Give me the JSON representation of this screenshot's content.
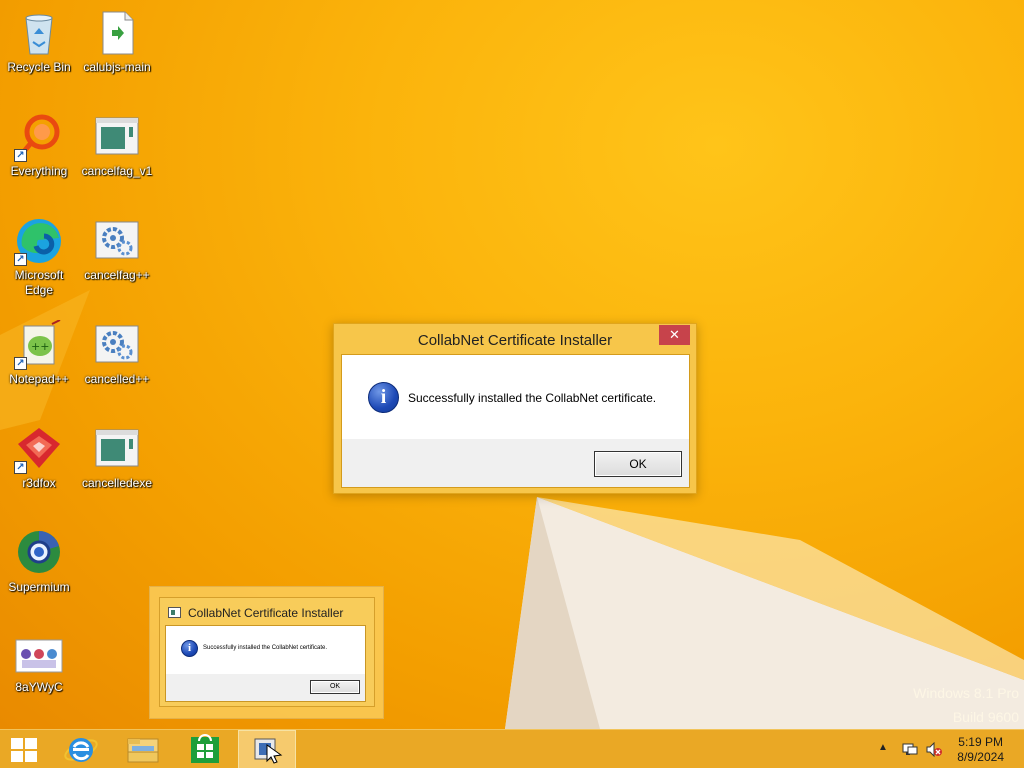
{
  "desktop": {
    "icons": [
      {
        "label": "Recycle Bin",
        "icon": "recycle-bin-icon"
      },
      {
        "label": "calubjs-main",
        "icon": "file-icon"
      },
      {
        "label": "Everything",
        "icon": "everything-search-icon"
      },
      {
        "label": "cancelfag_v1",
        "icon": "app-window-icon"
      },
      {
        "label": "Microsoft Edge",
        "icon": "edge-icon"
      },
      {
        "label": "cancelfag++",
        "icon": "gear-icon"
      },
      {
        "label": "Notepad++",
        "icon": "notepad-plus-plus-icon"
      },
      {
        "label": "cancelled++",
        "icon": "gear-icon"
      },
      {
        "label": "r3dfox",
        "icon": "r3dfox-icon"
      },
      {
        "label": "cancelledexe",
        "icon": "app-window-icon"
      },
      {
        "label": "Supermium",
        "icon": "supermium-icon"
      },
      {
        "label": "8aYWyC",
        "icon": "image-icon"
      }
    ],
    "watermark": {
      "line1": "Windows 8.1 Pro",
      "line2": "Build 9600"
    }
  },
  "dialog": {
    "title": "CollabNet Certificate Installer",
    "close_label": "✕",
    "message": "Successfully installed the CollabNet certificate.",
    "ok_label": "OK"
  },
  "thumbnail": {
    "title": "CollabNet Certificate Installer",
    "message": "Successfully installed the CollabNet certificate.",
    "ok_label": "OK"
  },
  "taskbar": {
    "items": [
      "start-button",
      "internet-explorer",
      "file-explorer",
      "store",
      "collabnet-installer"
    ],
    "clock": {
      "time": "5:19 PM",
      "date": "8/9/2024"
    },
    "tray_chevron": "▲"
  }
}
